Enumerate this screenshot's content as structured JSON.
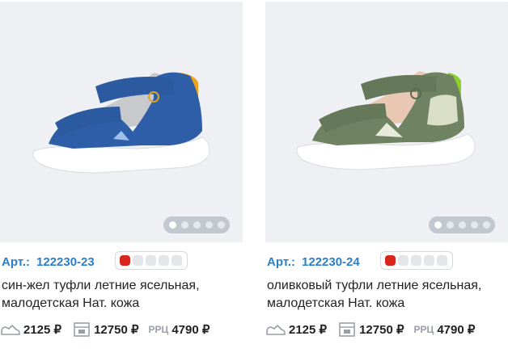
{
  "products": [
    {
      "article_label": "Арт.:",
      "article": "122230-23",
      "name_line1": "син-жел туфли летние ясельная,",
      "name_line2": "малодетская Нат. кожа",
      "price_pair": "2125 ₽",
      "price_box": "12750 ₽",
      "rrc_label": "РРЦ",
      "rrc_price": "4790 ₽",
      "selected_color": "#d8261c",
      "shoe_colors": {
        "upper": "#2f5ea8",
        "strap": "#2c5aa0",
        "heel": "#f0a21a",
        "lining": "#c8c9cc",
        "sole": "#ffffff"
      },
      "gallery": {
        "slides": 5,
        "active": 1
      }
    },
    {
      "article_label": "Арт.:",
      "article": "122230-24",
      "name_line1": "оливковый туфли летние ясельная,",
      "name_line2": "малодетская Нат. кожа",
      "price_pair": "2125 ₽",
      "price_box": "12750 ₽",
      "rrc_label": "РРЦ",
      "rrc_price": "4790 ₽",
      "selected_color": "#d8261c",
      "shoe_colors": {
        "upper": "#6f8262",
        "strap": "#66785a",
        "heel": "#8ccf2a",
        "lining": "#e8c8b2",
        "sole": "#ffffff"
      },
      "gallery": {
        "slides": 5,
        "active": 1
      }
    }
  ]
}
